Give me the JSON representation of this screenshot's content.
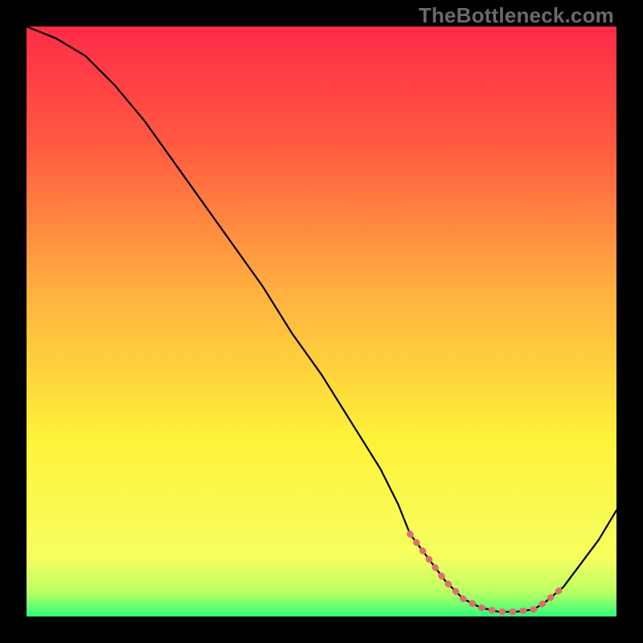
{
  "watermark": "TheBottleneck.com",
  "chart_data": {
    "type": "line",
    "title": "",
    "xlabel": "",
    "ylabel": "",
    "xlim": [
      0,
      100
    ],
    "ylim": [
      0,
      100
    ],
    "gradient_stops": [
      {
        "offset": 0,
        "color": "#ff2b48"
      },
      {
        "offset": 20,
        "color": "#ff5a41"
      },
      {
        "offset": 45,
        "color": "#ffb040"
      },
      {
        "offset": 70,
        "color": "#fff23a"
      },
      {
        "offset": 90,
        "color": "#f6ff60"
      },
      {
        "offset": 96,
        "color": "#b8ff63"
      },
      {
        "offset": 100,
        "color": "#2dff7a"
      }
    ],
    "series": [
      {
        "name": "bottleneck-curve",
        "stroke": "#000000",
        "stroke_width": 2.2,
        "x": [
          0,
          5,
          10,
          15,
          20,
          25,
          30,
          35,
          40,
          45,
          50,
          55,
          60,
          63,
          65,
          68,
          71,
          74,
          77,
          80,
          83,
          86,
          88,
          91,
          94,
          97,
          100
        ],
        "y": [
          100,
          98,
          95,
          90,
          84,
          77,
          70,
          63,
          56,
          48,
          41,
          33,
          25,
          19,
          14,
          10,
          6,
          3,
          1.5,
          0.8,
          0.8,
          1.2,
          2.5,
          5,
          9,
          13,
          18
        ]
      },
      {
        "name": "optimal-band",
        "stroke": "#e06d71",
        "stroke_width": 8,
        "linecap": "round",
        "dash": "1 12",
        "x": [
          65,
          68,
          71,
          74,
          77,
          80,
          83,
          86,
          88,
          91
        ],
        "y": [
          14,
          10,
          6,
          3,
          1.5,
          0.8,
          0.8,
          1.2,
          2.5,
          5
        ]
      }
    ]
  }
}
